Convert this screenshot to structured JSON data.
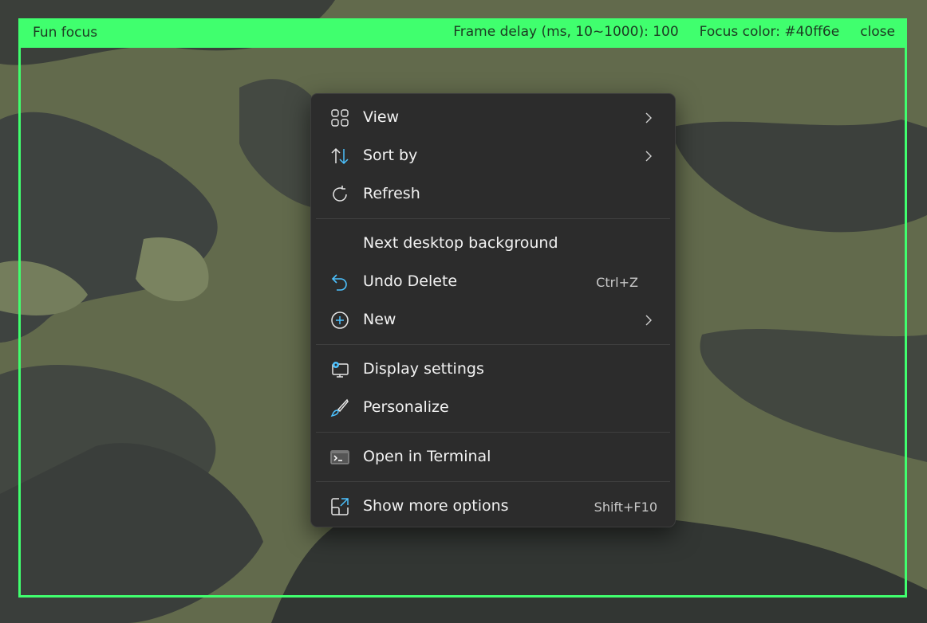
{
  "overlay": {
    "title": "Fun focus",
    "frame_delay_label": "Frame delay (ms, 10~1000):",
    "frame_delay_value": "100",
    "focus_color_label": "Focus color:",
    "focus_color_value": "#40ff6e",
    "close_label": "close",
    "accent_color": "#40ff6e"
  },
  "context_menu": {
    "items": [
      {
        "label": "View",
        "icon": "grid-view-icon",
        "submenu": true
      },
      {
        "label": "Sort by",
        "icon": "sort-arrows-icon",
        "submenu": true
      },
      {
        "label": "Refresh",
        "icon": "refresh-icon"
      },
      {
        "label": "Next desktop background"
      },
      {
        "label": "Undo Delete",
        "icon": "undo-icon",
        "shortcut": "Ctrl+Z"
      },
      {
        "label": "New",
        "icon": "plus-circle-icon",
        "submenu": true
      },
      {
        "label": "Display settings",
        "icon": "display-settings-icon"
      },
      {
        "label": "Personalize",
        "icon": "brush-icon"
      },
      {
        "label": "Open in Terminal",
        "icon": "terminal-icon"
      },
      {
        "label": "Show more options",
        "icon": "expand-icon",
        "shortcut": "Shift+F10"
      }
    ]
  }
}
